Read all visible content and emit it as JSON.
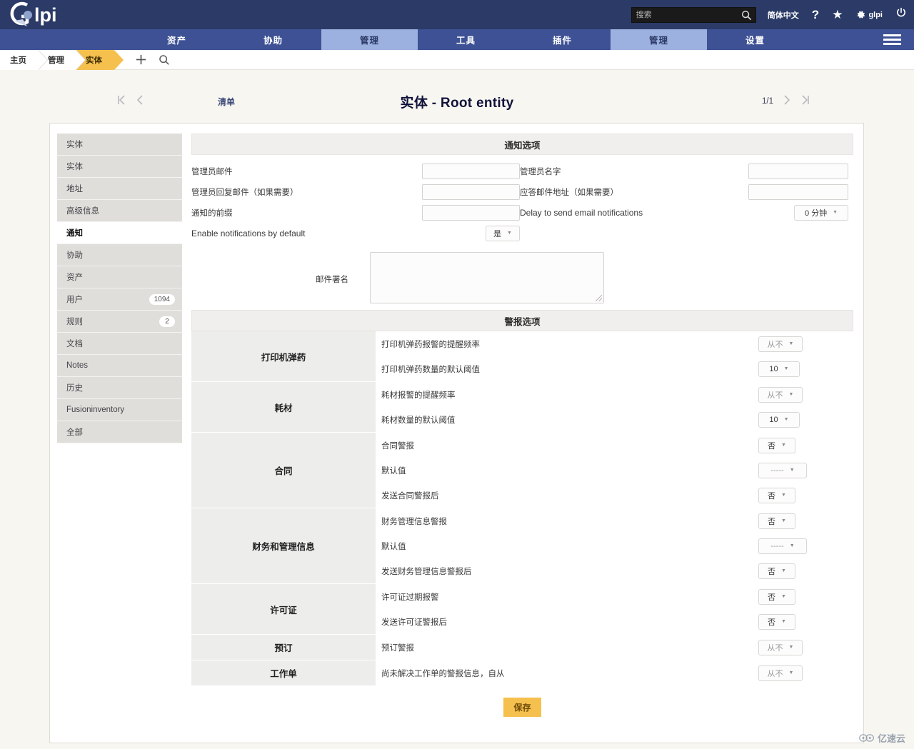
{
  "header": {
    "brand": "glpi",
    "search_placeholder": "搜索",
    "language": "简体中文",
    "help_icon": "?",
    "star_icon": "★",
    "account_name": "glpi",
    "power_icon": "power-icon"
  },
  "nav": {
    "items": [
      {
        "label": "资产",
        "active": false
      },
      {
        "label": "协助",
        "active": false
      },
      {
        "label": "管理",
        "active": true
      },
      {
        "label": "工具",
        "active": false
      },
      {
        "label": "插件",
        "active": false
      },
      {
        "label": "管理",
        "active": true
      },
      {
        "label": "设置",
        "active": false
      }
    ]
  },
  "breadcrumb": {
    "items": [
      {
        "label": "主页",
        "active": false
      },
      {
        "label": "管理",
        "active": false
      },
      {
        "label": "实体",
        "active": true
      }
    ],
    "add_icon": "+",
    "search_icon": "search-icon"
  },
  "titlebar": {
    "list_link": "清单",
    "title": "实体 - Root entity",
    "page_indicator": "1/1"
  },
  "sidebar": {
    "items": [
      {
        "label": "实体",
        "badge": "",
        "active": false
      },
      {
        "label": "实体",
        "badge": "",
        "active": false
      },
      {
        "label": "地址",
        "badge": "",
        "active": false
      },
      {
        "label": "高级信息",
        "badge": "",
        "active": false
      },
      {
        "label": "通知",
        "badge": "",
        "active": true
      },
      {
        "label": "协助",
        "badge": "",
        "active": false
      },
      {
        "label": "资产",
        "badge": "",
        "active": false
      },
      {
        "label": "用户",
        "badge": "1094",
        "active": false
      },
      {
        "label": "规则",
        "badge": "2",
        "active": false
      },
      {
        "label": "文档",
        "badge": "",
        "active": false
      },
      {
        "label": "Notes",
        "badge": "",
        "active": false
      },
      {
        "label": "历史",
        "badge": "",
        "active": false
      },
      {
        "label": "Fusioninventory",
        "badge": "",
        "active": false
      },
      {
        "label": "全部",
        "badge": "",
        "active": false
      }
    ]
  },
  "notification_section": {
    "title": "通知选项",
    "fields": {
      "admin_email_label": "管理员邮件",
      "admin_email_value": "",
      "admin_name_label": "管理员名字",
      "admin_name_value": "",
      "admin_reply_label": "管理员回复邮件（如果需要）",
      "admin_reply_value": "",
      "reply_to_label": "应答邮件地址（如果需要）",
      "reply_to_value": "",
      "prefix_label": "通知的前缀",
      "prefix_value": "",
      "delay_label": "Delay to send email notifications",
      "delay_value": "0 分钟",
      "enable_label": "Enable notifications by default",
      "enable_value": "是",
      "signature_label": "邮件署名",
      "signature_value": ""
    }
  },
  "alert_section": {
    "title": "警报选项",
    "groups": [
      {
        "category": "打印机弹药",
        "options": [
          {
            "label": "打印机弹药报警的提醒频率",
            "value": "从不",
            "muted": true
          },
          {
            "label": "打印机弹药数量的默认阈值",
            "value": "10",
            "muted": false
          }
        ]
      },
      {
        "category": "耗材",
        "options": [
          {
            "label": "耗材报警的提醒频率",
            "value": "从不",
            "muted": true
          },
          {
            "label": "耗材数量的默认阈值",
            "value": "10",
            "muted": false
          }
        ]
      },
      {
        "category": "合同",
        "options": [
          {
            "label": "合同警报",
            "value": "否",
            "muted": false
          },
          {
            "label": "默认值",
            "value": "-----",
            "muted": true
          },
          {
            "label": "发送合同警报后",
            "value": "否",
            "muted": false
          }
        ]
      },
      {
        "category": "财务和管理信息",
        "options": [
          {
            "label": "财务管理信息警报",
            "value": "否",
            "muted": false
          },
          {
            "label": "默认值",
            "value": "-----",
            "muted": true
          },
          {
            "label": "发送财务管理信息警报后",
            "value": "否",
            "muted": false
          }
        ]
      },
      {
        "category": "许可证",
        "options": [
          {
            "label": "许可证过期报警",
            "value": "否",
            "muted": false
          },
          {
            "label": "发送许可证警报后",
            "value": "否",
            "muted": false
          }
        ]
      },
      {
        "category": "预订",
        "options": [
          {
            "label": "预订警报",
            "value": "从不",
            "muted": true
          }
        ]
      },
      {
        "category": "工作单",
        "options": [
          {
            "label": "尚未解决工作单的警报信息，自从",
            "value": "从不",
            "muted": true
          }
        ]
      }
    ]
  },
  "footer": {
    "save_label": "保存",
    "watermark": "亿速云"
  },
  "colors": {
    "header_bg": "#2b3a66",
    "nav_bg": "#3e5195",
    "nav_active_bg": "#9db1e0",
    "accent_yellow": "#f5c04e",
    "page_bg": "#f7f6f1"
  }
}
